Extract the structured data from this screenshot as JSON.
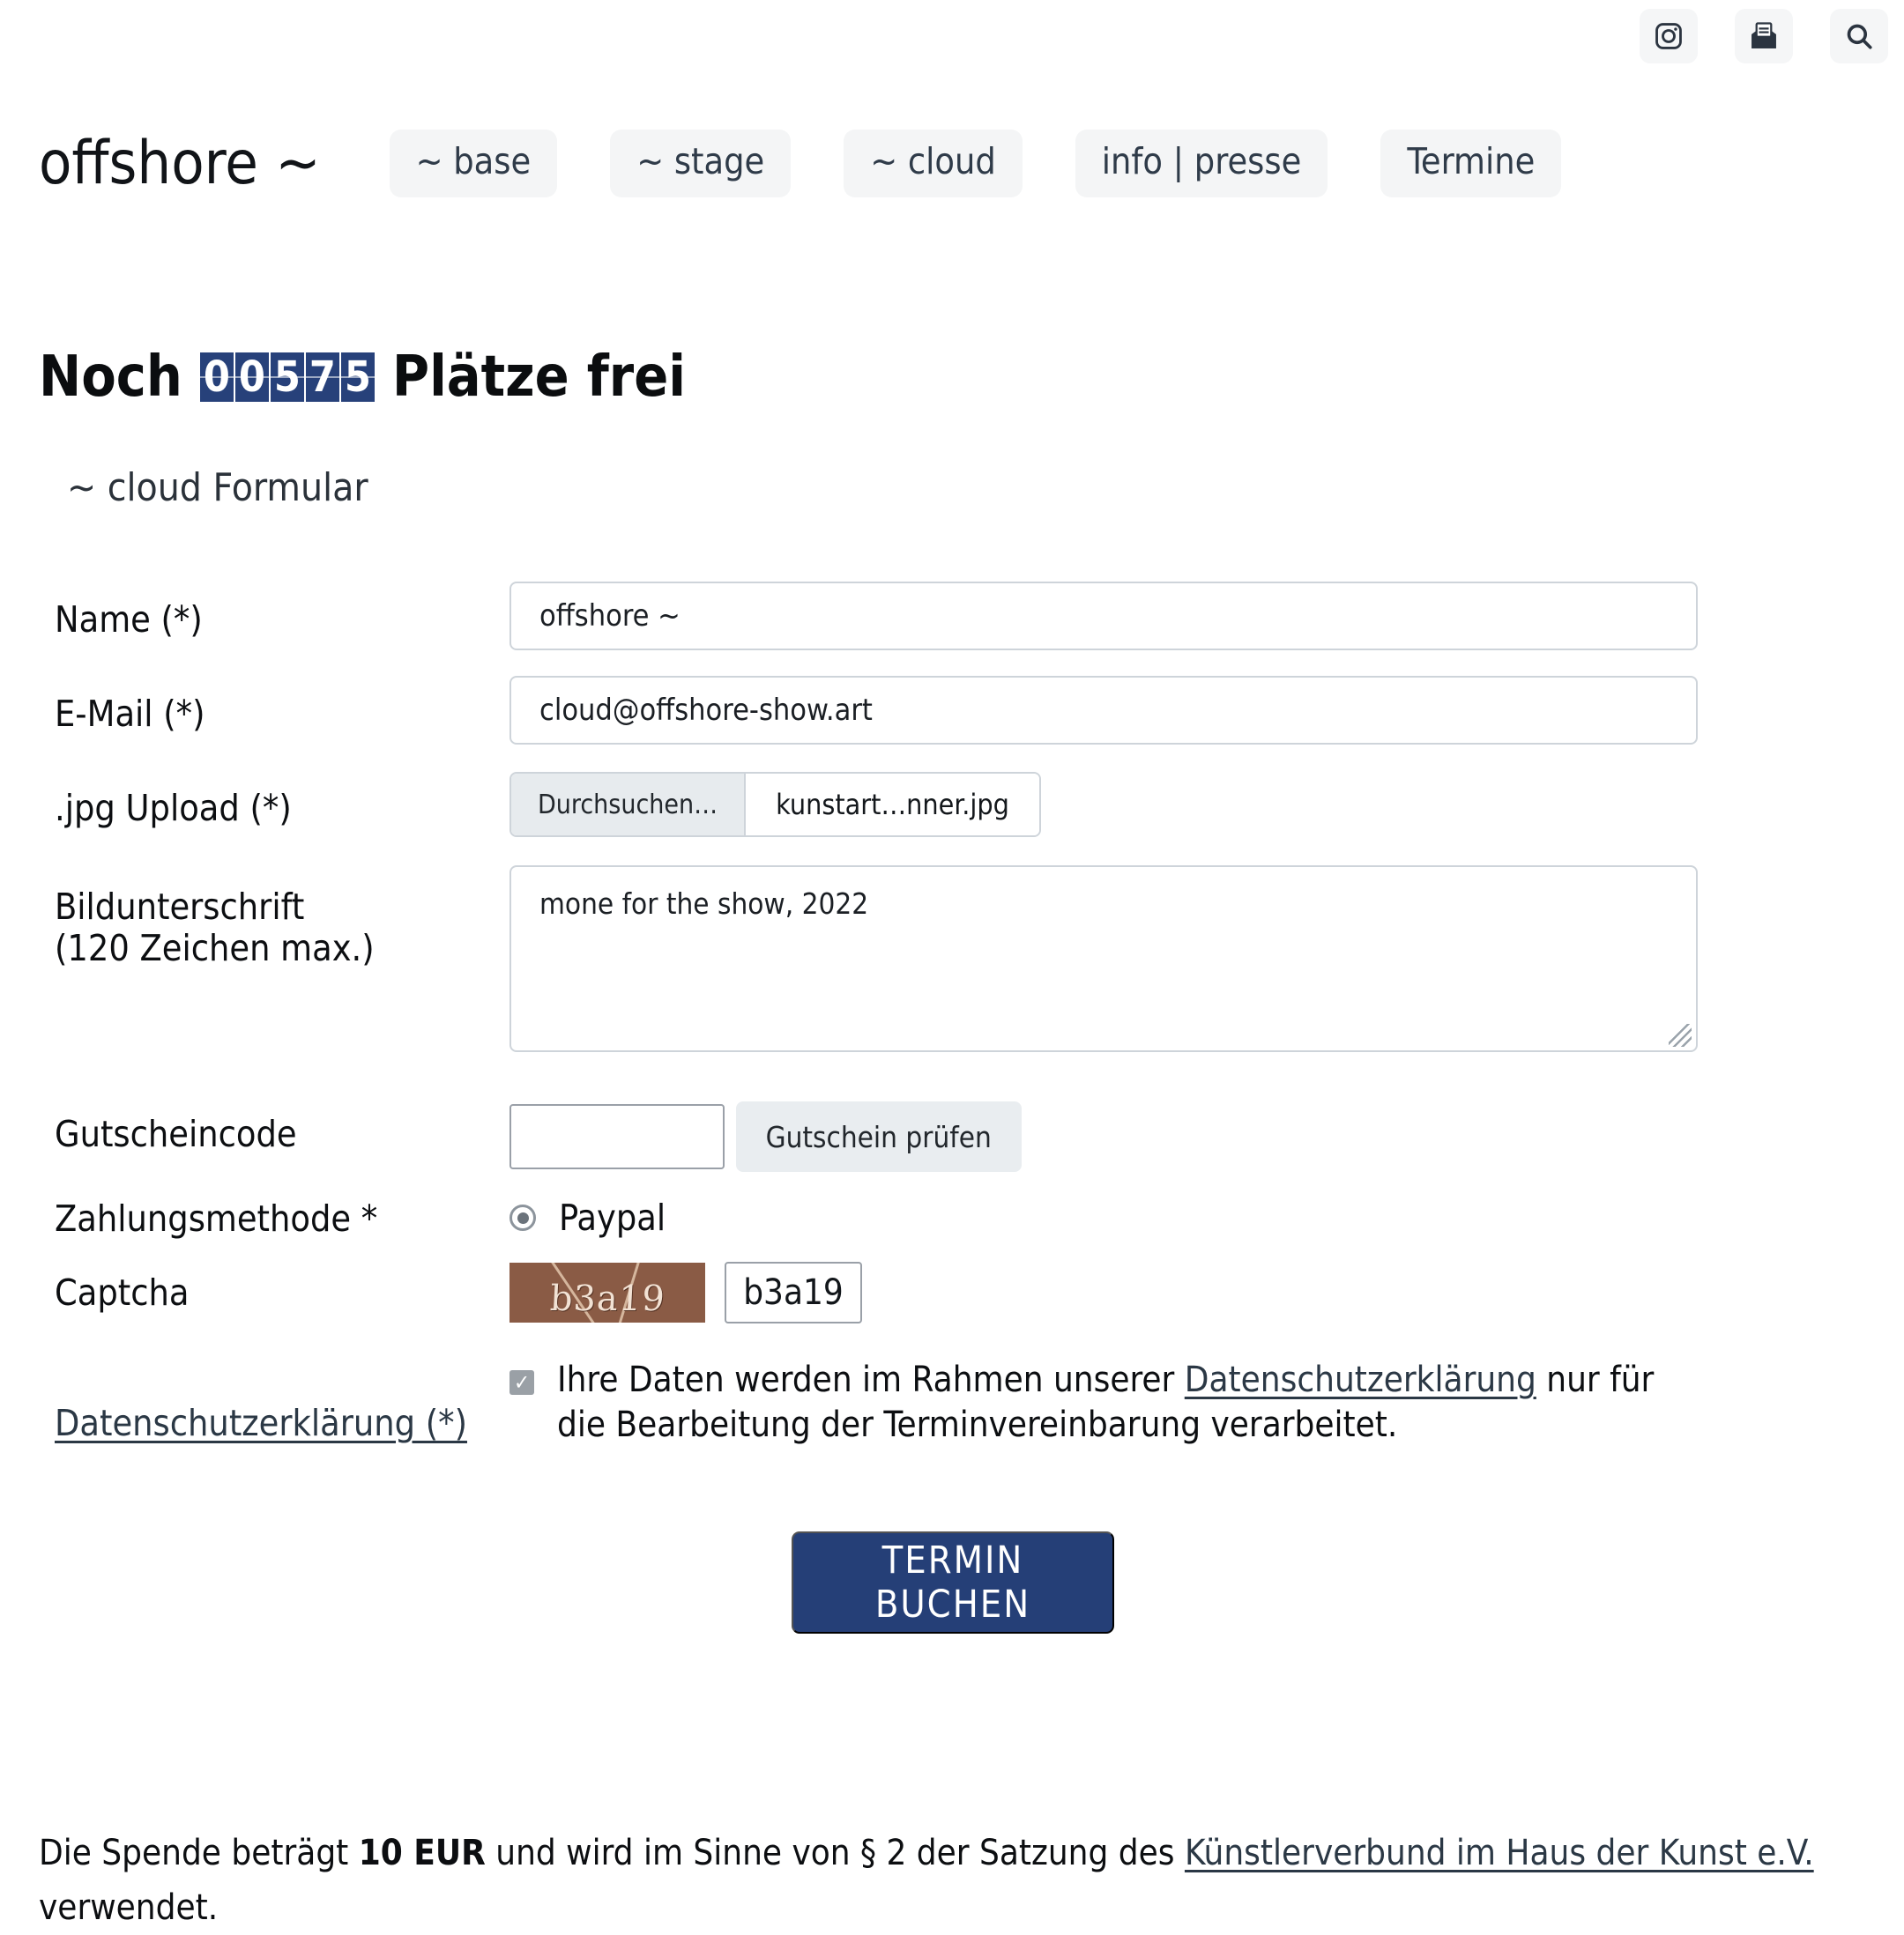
{
  "topbar": {
    "icons": [
      {
        "name": "instagram-icon",
        "label": "Instagram"
      },
      {
        "name": "newsletter-icon",
        "label": "Newsletter"
      },
      {
        "name": "search-icon",
        "label": "Suche"
      }
    ]
  },
  "masthead": {
    "brand": "offshore ~",
    "nav": [
      {
        "label": "~ base"
      },
      {
        "label": "~ stage"
      },
      {
        "label": "~ cloud"
      },
      {
        "label": "info | presse"
      },
      {
        "label": "Termine"
      }
    ]
  },
  "headline": {
    "prefix": "Noch",
    "counter_digits": [
      "0",
      "0",
      "5",
      "7",
      "5"
    ],
    "counter_value": "00575",
    "suffix": "Plätze frei"
  },
  "form": {
    "title": "~ cloud Formular",
    "name": {
      "label": "Name (*)",
      "value": "offshore ~",
      "placeholder": ""
    },
    "email": {
      "label": "E-Mail (*)",
      "value": "cloud@offshore-show.art",
      "placeholder": ""
    },
    "upload": {
      "label": ".jpg Upload (*)",
      "button": "Durchsuchen…",
      "filename": "kunstart…nner.jpg"
    },
    "caption": {
      "label": "Bildunterschrift\n(120 Zeichen max.)",
      "value": "mone for the show, 2022",
      "placeholder": ""
    },
    "voucher": {
      "label": "Gutscheincode",
      "value": "",
      "placeholder": "",
      "button": "Gutschein prüfen"
    },
    "payment": {
      "label": "Zahlungsmethode *",
      "option": "Paypal",
      "selected": true
    },
    "captcha": {
      "label": "Captcha",
      "image_text": "b3a19",
      "input_value": "b3a19"
    },
    "privacy": {
      "label": "Datenschutzerklärung (*)",
      "checked": true,
      "text_before": "Ihre Daten werden im Rahmen unserer ",
      "link": "Datenschutzerklärung",
      "text_after": " nur für die Bearbeitung der Terminvereinbarung verarbeitet."
    },
    "submit": "TERMIN BUCHEN"
  },
  "footnote": {
    "before_amount": "Die Spende beträgt ",
    "amount": "10 EUR",
    "after_amount": " und wird im Sinne von § 2 der Satzung des ",
    "link": "Künstlerverbund im Haus der Kunst e.V.",
    "tail": " verwendet."
  },
  "colors": {
    "accent_navy": "#253f77",
    "pill_bg": "#f4f5f6",
    "border": "#ced4da",
    "captcha_bg": "#8a5b45"
  }
}
